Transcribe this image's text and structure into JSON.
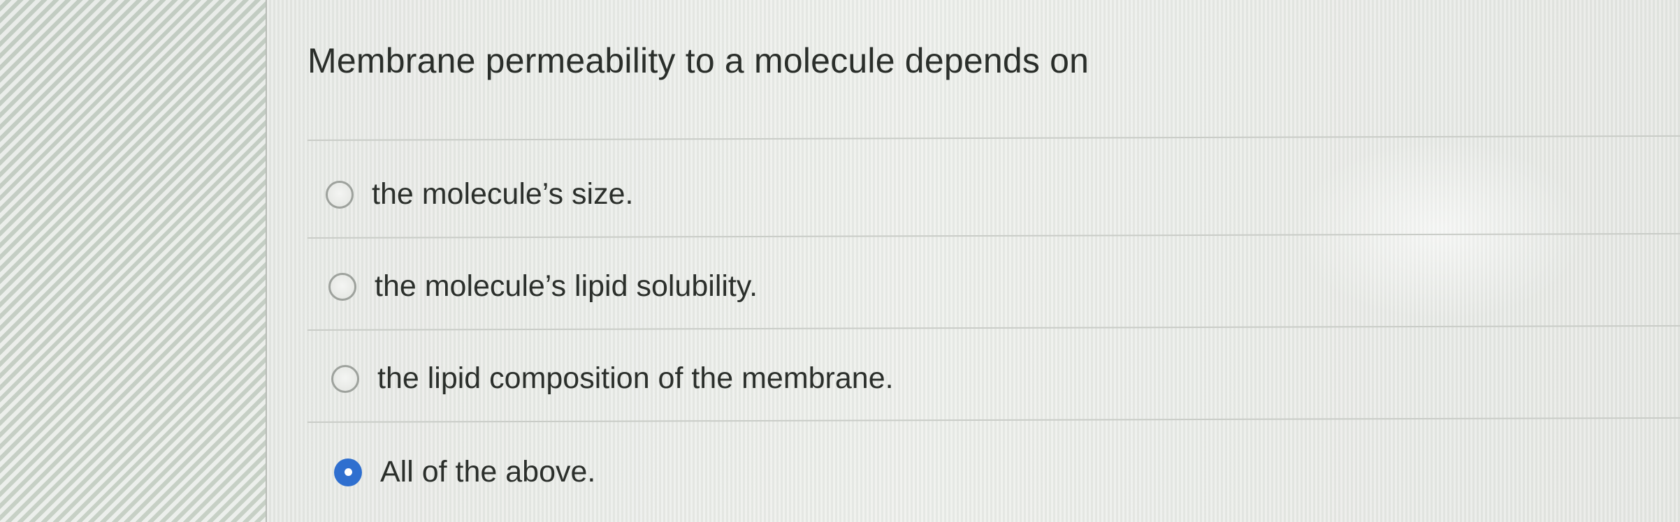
{
  "question": {
    "text": "Membrane permeability to a molecule depends on"
  },
  "options": [
    {
      "label": "the molecule’s size.",
      "selected": false
    },
    {
      "label": "the molecule’s lipid solubility.",
      "selected": false
    },
    {
      "label": "the lipid composition of the membrane.",
      "selected": false
    },
    {
      "label": "All of the above.",
      "selected": true
    }
  ],
  "colors": {
    "selected_radio": "#2f6fcf",
    "text": "#2b2f2b",
    "divider": "#c9ccc7"
  }
}
